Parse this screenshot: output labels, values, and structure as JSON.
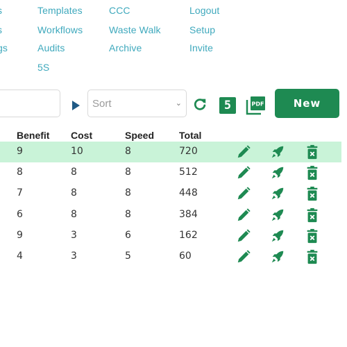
{
  "nav": {
    "col0": [
      "s",
      "s",
      "gs"
    ],
    "col1": [
      "Templates",
      "Workflows",
      "Audits",
      "5S"
    ],
    "col2": [
      "CCC",
      "Waste Walk",
      "Archive"
    ],
    "col3": [
      "Logout",
      "Setup",
      "Invite"
    ]
  },
  "toolbar": {
    "filter_value": "",
    "sort_placeholder": "Sort",
    "new_label": "New",
    "five_s_label": "5",
    "pdf_label": "PDF"
  },
  "table": {
    "columns": [
      "Benefit",
      "Cost",
      "Speed",
      "Total"
    ],
    "rows": [
      {
        "benefit": "9",
        "cost": "10",
        "speed": "8",
        "total": "720",
        "highlighted": true
      },
      {
        "benefit": "8",
        "cost": "8",
        "speed": "8",
        "total": "512",
        "highlighted": false
      },
      {
        "benefit": "7",
        "cost": "8",
        "speed": "8",
        "total": "448",
        "highlighted": false
      },
      {
        "benefit": "6",
        "cost": "8",
        "speed": "8",
        "total": "384",
        "highlighted": false
      },
      {
        "benefit": "9",
        "cost": "3",
        "speed": "6",
        "total": "162",
        "highlighted": false
      },
      {
        "benefit": "4",
        "cost": "3",
        "speed": "5",
        "total": "60",
        "highlighted": false
      }
    ]
  },
  "colors": {
    "link": "#3fa9bd",
    "accent_green": "#1e8a52",
    "highlight_row": "#c9f3d8",
    "play_arrow": "#1f5a85"
  },
  "icons": {
    "edit": "pencil-icon",
    "launch": "rocket-icon",
    "delete": "trash-icon",
    "refresh": "refresh-icon",
    "five_s": "five-s-icon",
    "pdf": "pdf-icon",
    "play": "play-icon"
  }
}
